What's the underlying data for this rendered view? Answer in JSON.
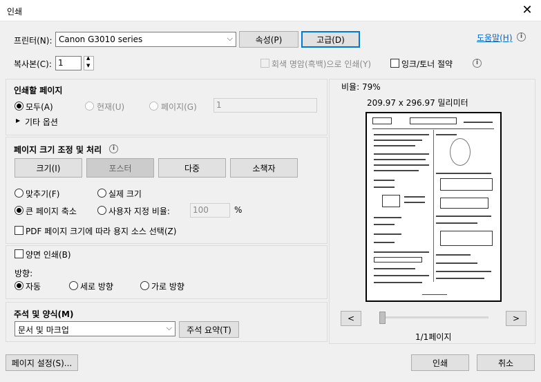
{
  "window": {
    "title": "인쇄",
    "close": "✕"
  },
  "printer": {
    "label": "프린터(N):",
    "selected": "Canon G3010 series",
    "properties_button": "속성(P)",
    "advanced_button": "고급(D)",
    "help_link": "도움말(H)"
  },
  "copies": {
    "label": "복사본(C):",
    "value": "1"
  },
  "options": {
    "grayscale_label": "회색 명암(흑백)으로 인쇄(Y)",
    "ink_save_label": "잉크/토너 절약"
  },
  "pages_section": {
    "title": "인쇄할 페이지",
    "all_label": "모두(A)",
    "current_label": "현재(U)",
    "pages_label": "페이지(G)",
    "pages_value": "1",
    "more_options": "기타 옵션"
  },
  "sizing_section": {
    "title": "페이지 크기 조정 및 처리",
    "tabs": [
      "크기(I)",
      "포스터",
      "다중",
      "소책자"
    ],
    "fit_label": "맞추기(F)",
    "actual_size_label": "실제 크기",
    "shrink_label": "큰 페이지 축소",
    "custom_scale_label": "사용자 지정 비율:",
    "custom_scale_value": "100",
    "percent_sign": "%",
    "pdf_source_label": "PDF 페이지 크기에 따라 용지 소스 선택(Z)"
  },
  "duplex": {
    "label": "양면 인쇄(B)"
  },
  "orientation": {
    "title": "방향:",
    "auto_label": "자동",
    "portrait_label": "세로 방향",
    "landscape_label": "가로 방향"
  },
  "comments": {
    "title": "주석 및 양식(M)",
    "selected": "문서 및 마크업",
    "summary_button": "주석 요약(T)"
  },
  "preview": {
    "scale_label": "비율: 79%",
    "dimensions": "209.97 x 296.97 밀리미터",
    "prev": "<",
    "next": ">",
    "page_indicator": "1/1페이지"
  },
  "footer": {
    "page_setup_button": "페이지 설정(S)...",
    "print_button": "인쇄",
    "cancel_button": "취소"
  }
}
